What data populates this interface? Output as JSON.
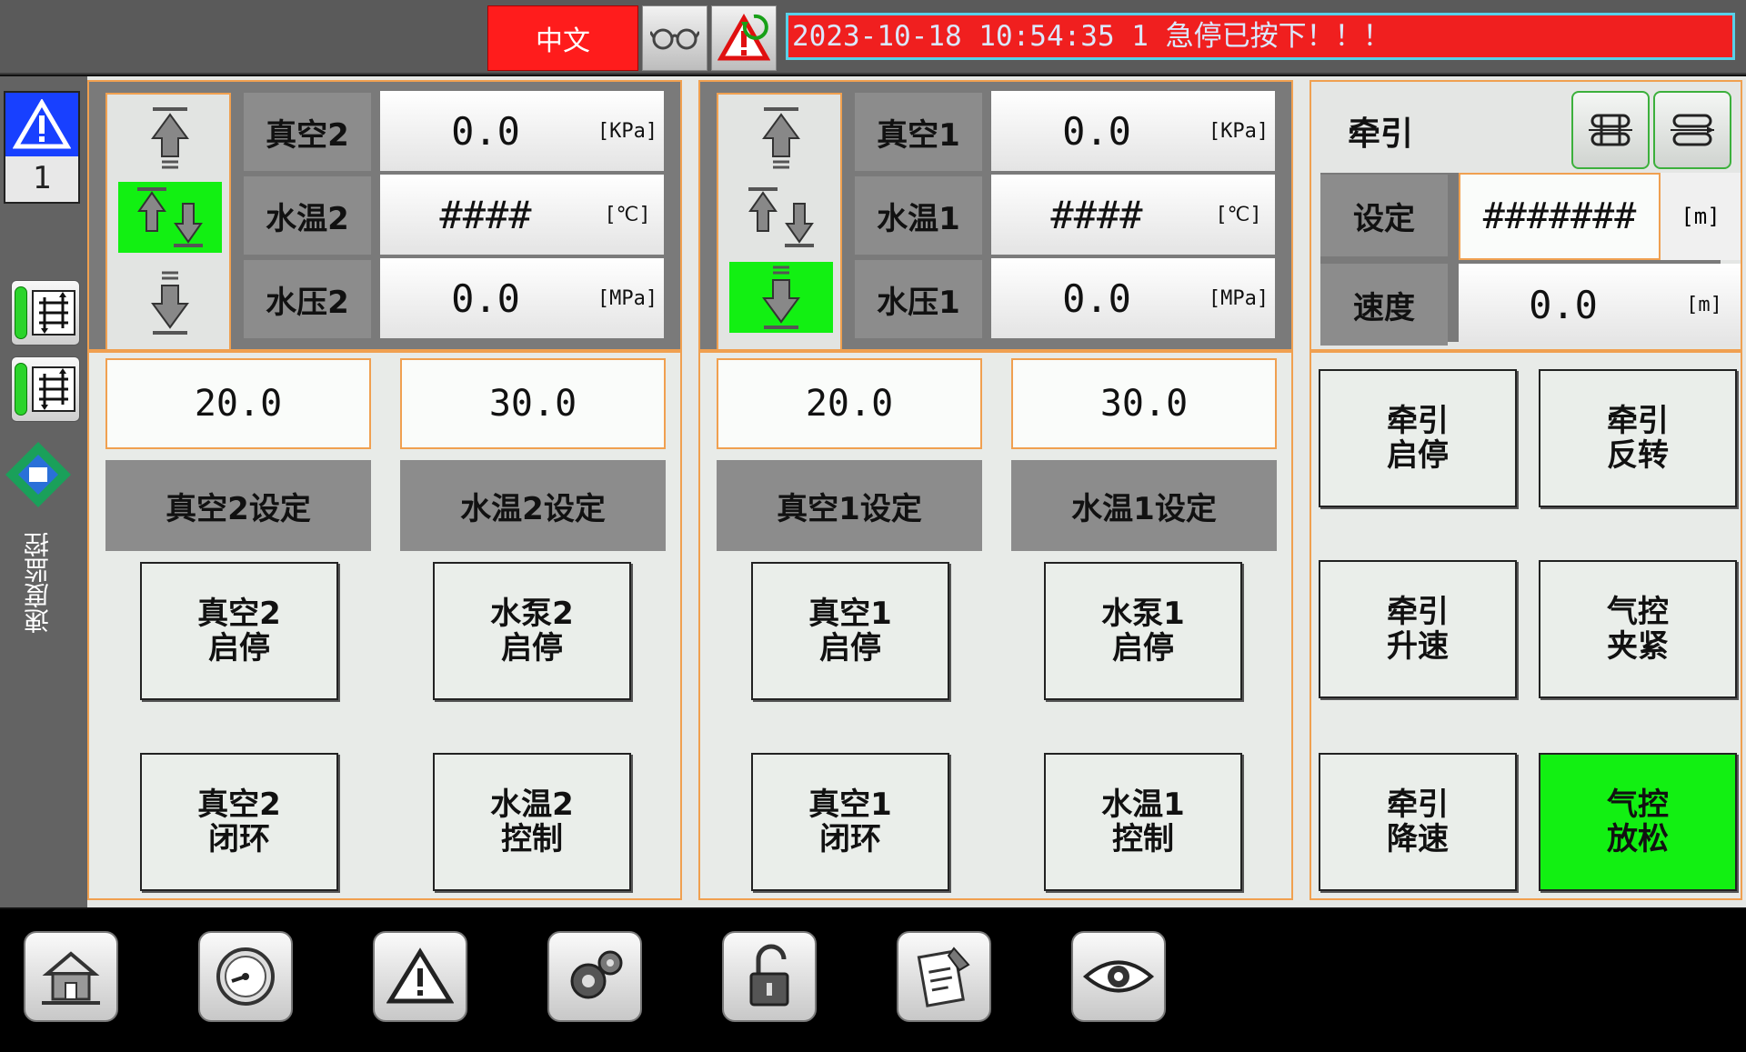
{
  "topbar": {
    "language_label": "中文",
    "glasses_icon": "glasses-icon",
    "alarm_ack_icon": "alarm-refresh-icon",
    "alarm_message": "2023-10-18 10:54:35  1 急停已按下！！！",
    "colors": {
      "banner": "#f01f1f",
      "language": "#ff1c1c"
    }
  },
  "sidebar": {
    "alarm_count": "1",
    "vertical_label": "速度监控"
  },
  "panel2": {
    "readings": [
      {
        "label": "真空2",
        "value": "0.0",
        "unit": "[KPa]"
      },
      {
        "label": "水温2",
        "value": "####",
        "unit": "[℃]"
      },
      {
        "label": "水压2",
        "value": "0.0",
        "unit": "[MPa]"
      }
    ],
    "direction_active": "middle",
    "setpoints": [
      {
        "value": "20.0",
        "label": "真空2设定"
      },
      {
        "value": "30.0",
        "label": "水温2设定"
      }
    ],
    "buttons": [
      {
        "label": "真空2\n启停",
        "active": false
      },
      {
        "label": "水泵2\n启停",
        "active": false
      },
      {
        "label": "真空2\n闭环",
        "active": false
      },
      {
        "label": "水温2\n控制",
        "active": false
      }
    ]
  },
  "panel1": {
    "readings": [
      {
        "label": "真空1",
        "value": "0.0",
        "unit": "[KPa]"
      },
      {
        "label": "水温1",
        "value": "####",
        "unit": "[℃]"
      },
      {
        "label": "水压1",
        "value": "0.0",
        "unit": "[MPa]"
      }
    ],
    "direction_active": "bottom",
    "setpoints": [
      {
        "value": "20.0",
        "label": "真空1设定"
      },
      {
        "value": "30.0",
        "label": "水温1设定"
      }
    ],
    "buttons": [
      {
        "label": "真空1\n启停",
        "active": false
      },
      {
        "label": "水泵1\n启停",
        "active": false
      },
      {
        "label": "真空1\n闭环",
        "active": false
      },
      {
        "label": "水温1\n控制",
        "active": false
      }
    ]
  },
  "traction": {
    "title": "牵引",
    "set_label": "设定",
    "set_value": "#######",
    "set_unit": "[m]",
    "speed_label": "速度",
    "speed_value": "0.0",
    "speed_unit": "[m]",
    "buttons": [
      {
        "label": "牵引\n启停",
        "active": false
      },
      {
        "label": "牵引\n反转",
        "active": false
      },
      {
        "label": "牵引\n升速",
        "active": false
      },
      {
        "label": "气控\n夹紧",
        "active": false
      },
      {
        "label": "牵引\n降速",
        "active": false
      },
      {
        "label": "气控\n放松",
        "active": true
      }
    ],
    "active_color": "#12f012"
  },
  "bottom_nav": [
    {
      "icon": "home-icon"
    },
    {
      "icon": "gauge-icon"
    },
    {
      "icon": "alarm-icon"
    },
    {
      "icon": "settings-gear-icon"
    },
    {
      "icon": "unlock-icon"
    },
    {
      "icon": "notepad-icon"
    },
    {
      "icon": "eye-icon"
    }
  ]
}
